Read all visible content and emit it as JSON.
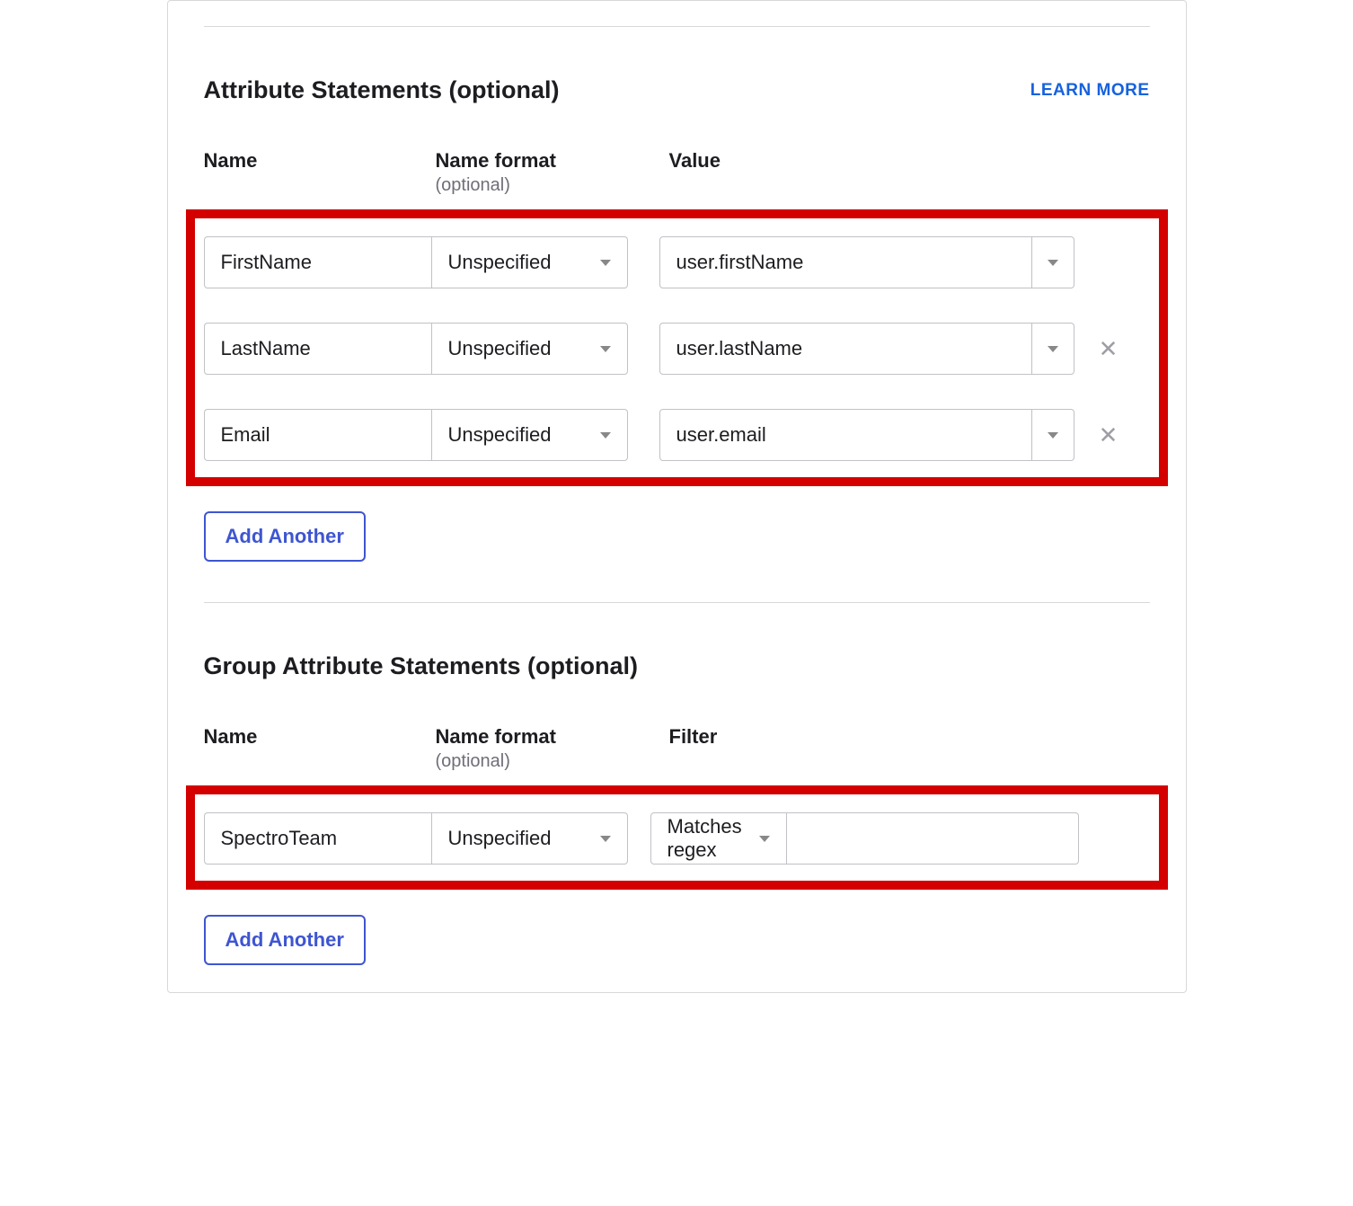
{
  "attr_section": {
    "title": "Attribute Statements (optional)",
    "learn_more": "LEARN MORE",
    "headers": {
      "name": "Name",
      "format": "Name format",
      "format_sub": "(optional)",
      "value": "Value"
    },
    "rows": [
      {
        "name": "FirstName",
        "format": "Unspecified",
        "value": "user.firstName",
        "removable": false
      },
      {
        "name": "LastName",
        "format": "Unspecified",
        "value": "user.lastName",
        "removable": true
      },
      {
        "name": "Email",
        "format": "Unspecified",
        "value": "user.email",
        "removable": true
      }
    ],
    "add_label": "Add Another"
  },
  "group_section": {
    "title": "Group Attribute Statements (optional)",
    "headers": {
      "name": "Name",
      "format": "Name format",
      "format_sub": "(optional)",
      "filter": "Filter"
    },
    "rows": [
      {
        "name": "SpectroTeam",
        "format": "Unspecified",
        "filter_type": "Matches regex",
        "filter_value": ""
      }
    ],
    "add_label": "Add Another"
  }
}
